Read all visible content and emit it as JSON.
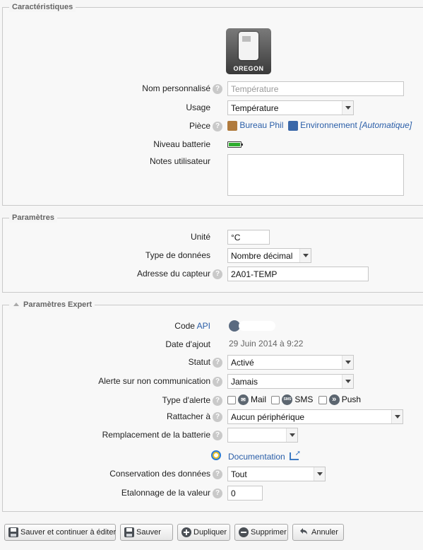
{
  "sections": {
    "characteristics": "Caractéristiques",
    "parameters": "Paramètres",
    "expert": "Paramètres Expert"
  },
  "device": {
    "brand_label": "OREGON"
  },
  "characteristics": {
    "custom_name_label": "Nom personnalisé",
    "custom_name_placeholder": "Température",
    "usage_label": "Usage",
    "usage_value": "Température",
    "room_label": "Pièce",
    "room_link": "Bureau Phil",
    "env_link": "Environnement",
    "env_auto": "[Automatique]",
    "battery_label": "Niveau batterie",
    "battery_level": 1.0,
    "notes_label": "Notes utilisateur",
    "notes_value": ""
  },
  "parameters": {
    "unit_label": "Unité",
    "unit_value": "°C",
    "datatype_label": "Type de données",
    "datatype_value": "Nombre décimal",
    "address_label": "Adresse du capteur",
    "address_value": "2A01-TEMP"
  },
  "expert": {
    "api_label": "Code",
    "api_link": "API",
    "added_label": "Date d'ajout",
    "added_value": "29 Juin 2014 à 9:22",
    "status_label": "Statut",
    "status_value": "Activé",
    "alert_nocomm_label": "Alerte sur non communication",
    "alert_nocomm_value": "Jamais",
    "alert_type_label": "Type d'alerte",
    "alert_mail": "Mail",
    "alert_sms": "SMS",
    "alert_push": "Push",
    "attach_label": "Rattacher à",
    "attach_value": "Aucun périphérique",
    "battery_replace_label": "Remplacement de la batterie",
    "battery_replace_value": "",
    "doc_link": "Documentation",
    "retention_label": "Conservation des données",
    "retention_value": "Tout",
    "calibration_label": "Etalonnage de la valeur",
    "calibration_value": "0"
  },
  "buttons": {
    "save_continue": "Sauver et continuer à éditer",
    "save": "Sauver",
    "duplicate": "Dupliquer",
    "delete": "Supprimer",
    "cancel": "Annuler"
  },
  "icons": {
    "help": "help-icon",
    "battery": "battery-icon",
    "sms_badge": "SMS",
    "push_badge": "»"
  }
}
